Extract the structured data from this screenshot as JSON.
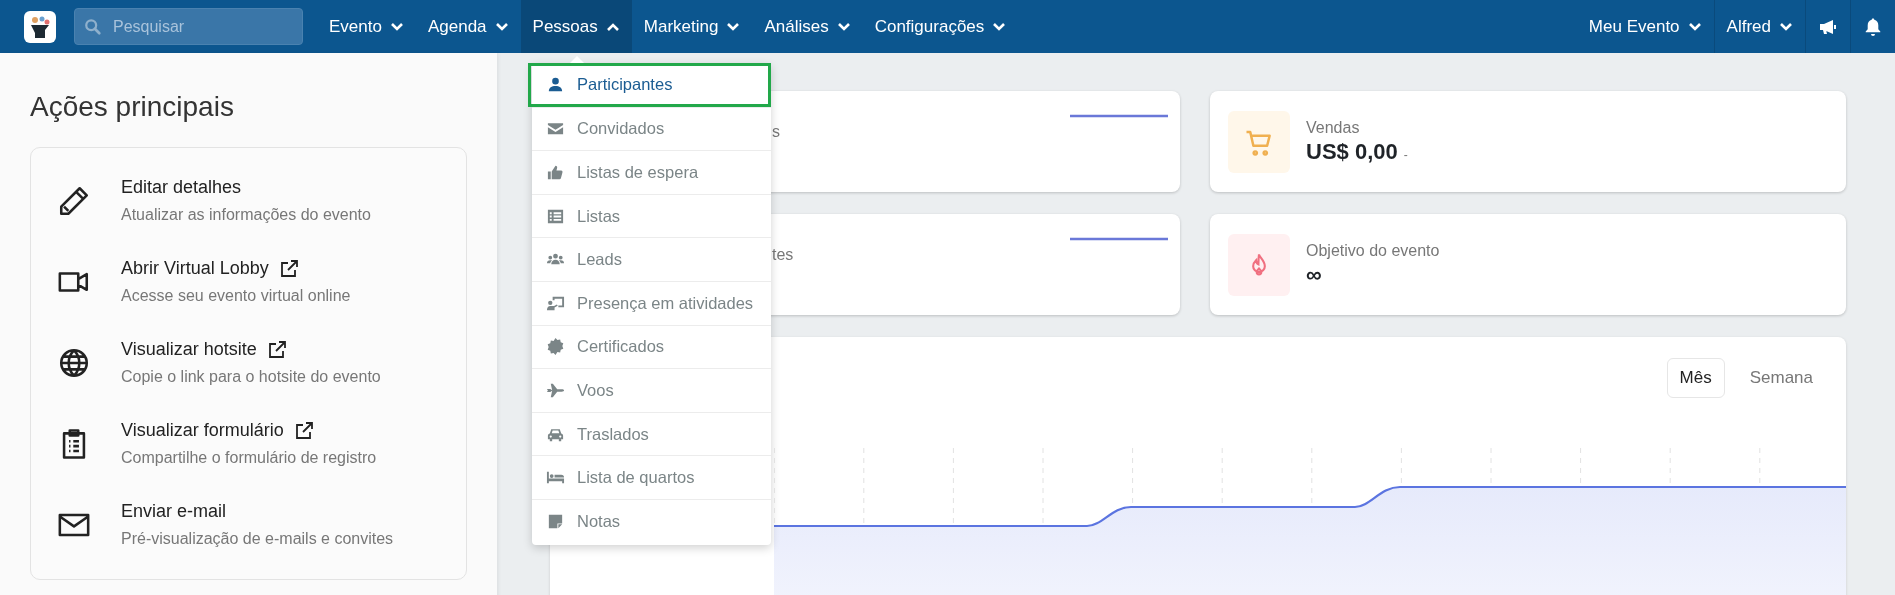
{
  "topbar": {
    "search": {
      "placeholder": "Pesquisar"
    },
    "nav": [
      {
        "label": "Evento",
        "expanded": false
      },
      {
        "label": "Agenda",
        "expanded": false
      },
      {
        "label": "Pessoas",
        "expanded": true
      },
      {
        "label": "Marketing",
        "expanded": false
      },
      {
        "label": "Análises",
        "expanded": false
      },
      {
        "label": "Configurações",
        "expanded": false
      }
    ],
    "account": [
      {
        "label": "Meu Evento"
      },
      {
        "label": "Alfred"
      }
    ]
  },
  "sidebar": {
    "title": "Ações principais",
    "actions": [
      {
        "title": "Editar detalhes",
        "subtitle": "Atualizar as informações do evento",
        "external": false
      },
      {
        "title": "Abrir Virtual Lobby",
        "subtitle": "Acesse seu evento virtual online",
        "external": true
      },
      {
        "title": "Visualizar hotsite",
        "subtitle": "Copie o link para o hotsite do evento",
        "external": true
      },
      {
        "title": "Visualizar formulário",
        "subtitle": "Compartilhe o formulário de registro",
        "external": true
      },
      {
        "title": "Enviar e-mail",
        "subtitle": "Pré-visualização de e-mails e convites",
        "external": false
      }
    ]
  },
  "people_menu": [
    {
      "label": "Participantes",
      "selected": true
    },
    {
      "label": "Convidados",
      "selected": false
    },
    {
      "label": "Listas de espera",
      "selected": false
    },
    {
      "label": "Listas",
      "selected": false
    },
    {
      "label": "Leads",
      "selected": false
    },
    {
      "label": "Presença em atividades",
      "selected": false
    },
    {
      "label": "Certificados",
      "selected": false
    },
    {
      "label": "Voos",
      "selected": false
    },
    {
      "label": "Traslados",
      "selected": false
    },
    {
      "label": "Lista de quartos",
      "selected": false
    },
    {
      "label": "Notas",
      "selected": false
    }
  ],
  "stats": [
    {
      "kind": "trend",
      "label": "s"
    },
    {
      "kind": "sales",
      "label": "Vendas",
      "value": "US$ 0,00",
      "note": "-"
    },
    {
      "kind": "trend",
      "label": "tes"
    },
    {
      "kind": "goal",
      "label": "Objetivo do evento",
      "value": "∞"
    }
  ],
  "chart_toggle": [
    {
      "label": "Mês",
      "selected": true
    },
    {
      "label": "Semana",
      "selected": false
    }
  ]
}
